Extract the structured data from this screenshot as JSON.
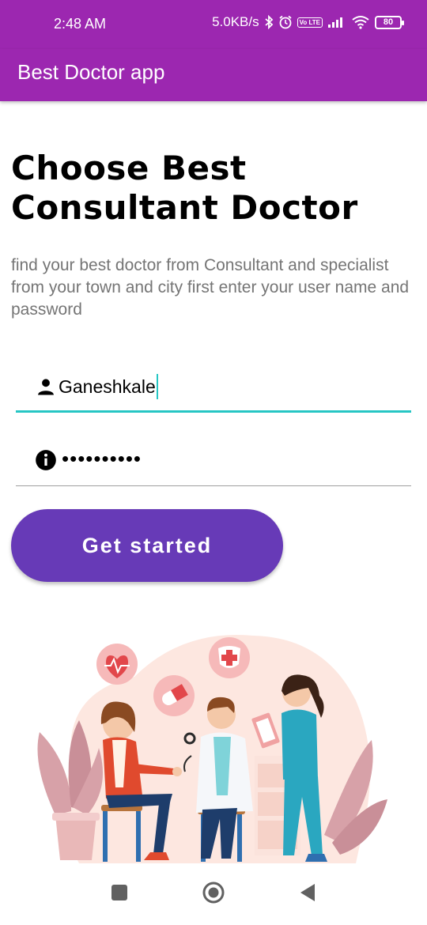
{
  "status_bar": {
    "time": "2:48 AM",
    "network_speed": "5.0KB/s",
    "volte": "Vo LTE",
    "battery": "80"
  },
  "app_bar": {
    "title": "Best Doctor app"
  },
  "main": {
    "heading_line1": "Choose Best",
    "heading_line2": "Consultant Doctor",
    "description": "find your best doctor from Consultant and specialist from your town and city first enter your user name and password"
  },
  "form": {
    "username_value": "Ganeshkale",
    "password_value": "••••••••••",
    "button_label": "Get started",
    "accent_color": "#26c6c4",
    "button_color": "#673ab7"
  },
  "colors": {
    "app_bar": "#9c27b0"
  },
  "icons": {
    "username": "person-icon",
    "password": "info-icon",
    "nav_recent": "square-icon",
    "nav_home": "circle-icon",
    "nav_back": "triangle-back-icon"
  }
}
